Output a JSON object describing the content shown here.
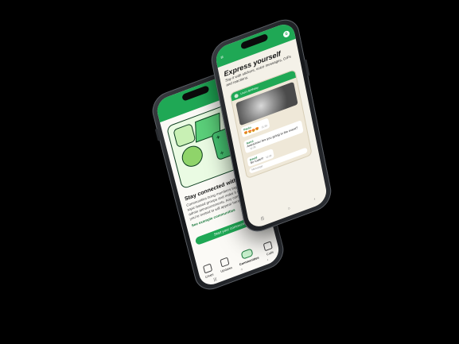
{
  "left_phone": {
    "illustration": {
      "people_icon": "people-icon",
      "box_icon": "cube-icon",
      "apple_icon": "apple-icon",
      "calc_symbols": [
        "+",
        "×",
        "÷",
        "="
      ]
    },
    "title": "Stay connected with a com",
    "body": "Communities bring members together in topic-based groups and make it easy to get admin announcements. Any community you're invited to will appear here.",
    "link": "See example communities",
    "cta": "Start your community",
    "nav": [
      {
        "label": "Chats",
        "icon": "chat-icon"
      },
      {
        "label": "Updates",
        "icon": "updates-icon"
      },
      {
        "label": "Communities",
        "icon": "communities-icon",
        "active": true
      },
      {
        "label": "Calls",
        "icon": "phone-icon"
      }
    ],
    "system_buttons": [
      "|||",
      "○",
      "‹"
    ]
  },
  "right_phone": {
    "title": "Express yourself",
    "subtitle": "Say it with stickers, voice messages, GIFs and reactions.",
    "chat_name": "Lisa's Birthday",
    "messages": [
      {
        "who": "Paulo",
        "text": "😍😍😍😍",
        "time": "11:32"
      },
      {
        "who": "Aarul",
        "text": "Awesome! Are you going to the event?",
        "time": "11:33"
      },
      {
        "who": "David",
        "text": "So Cute!!!",
        "time": "11:34"
      }
    ],
    "input_placeholder": "Message",
    "system_buttons": [
      "|||",
      "○",
      "‹"
    ],
    "logo_letter": "S",
    "menu_glyph": "≡"
  },
  "colors": {
    "brand_green": "#1fa855",
    "dark_green": "#0b3d1e",
    "light_green": "#eafbe3",
    "background": "#000000"
  }
}
